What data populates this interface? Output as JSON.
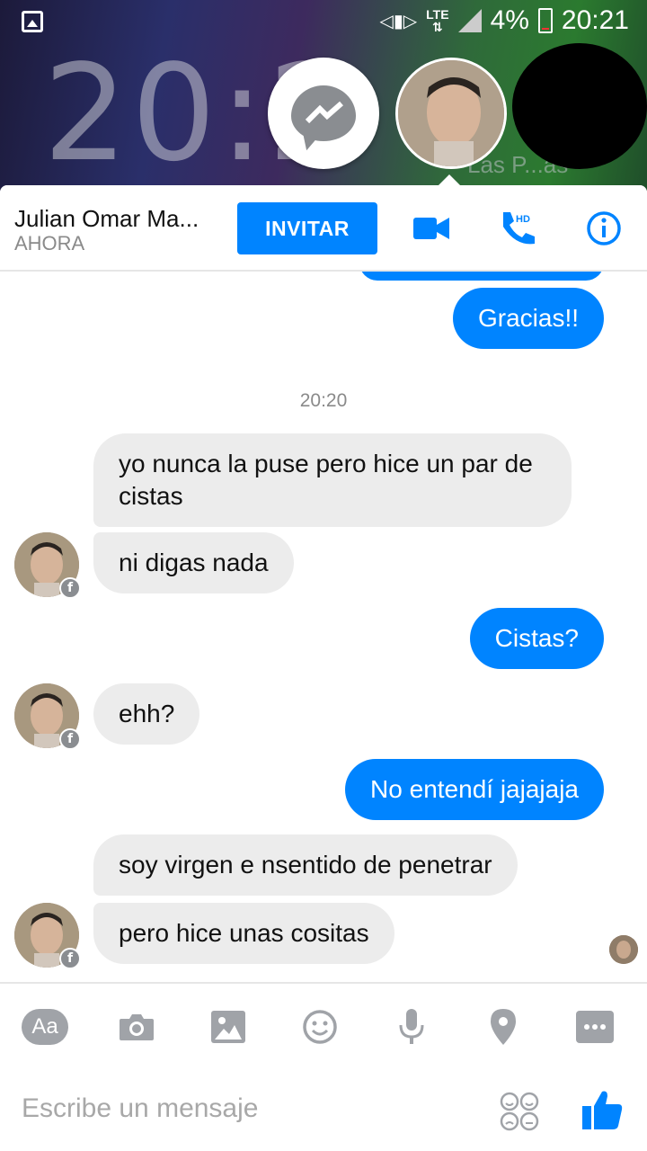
{
  "status_bar": {
    "lte": "LTE",
    "battery": "4%",
    "time": "20:21"
  },
  "lockscreen": {
    "clock": "20:2",
    "city": "Las P...as"
  },
  "header": {
    "contact_name": "Julian Omar Ma...",
    "contact_status": "AHORA",
    "invite_label": "INVITAR",
    "call_hd_badge": "HD"
  },
  "messages": [
    {
      "from": "me",
      "text": "Gracias!!"
    },
    {
      "type": "timestamp",
      "text": "20:20"
    },
    {
      "from": "them",
      "text": "yo nunca la puse pero hice un par de cistas"
    },
    {
      "from": "them",
      "text": "ni digas nada"
    },
    {
      "from": "me",
      "text": "Cistas?"
    },
    {
      "from": "them",
      "text": "ehh?"
    },
    {
      "from": "me",
      "text": "No entendí jajajaja"
    },
    {
      "from": "them",
      "text": "soy virgen e nsentido de penetrar"
    },
    {
      "from": "them",
      "text": "pero hice unas cositas"
    }
  ],
  "composer": {
    "text_icon_label": "Aa",
    "placeholder": "Escribe un mensaje",
    "icons": [
      "camera-icon",
      "image-icon",
      "emoji-icon",
      "microphone-icon",
      "location-icon",
      "more-icon",
      "stickers-icon",
      "thumbs-up-icon"
    ]
  },
  "colors": {
    "accent": "#0084ff",
    "incoming_bubble": "#ececec",
    "icon_gray": "#a0a3a8"
  }
}
